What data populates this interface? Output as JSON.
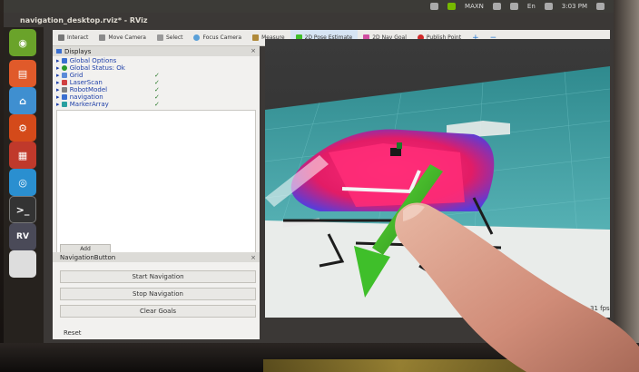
{
  "window": {
    "title": "navigation_desktop.rviz* - RViz"
  },
  "top_panel": {
    "network": "MAXN",
    "keyboard": "En",
    "time": "3:03 PM"
  },
  "toolbar": {
    "items": [
      {
        "label": "Interact",
        "icon": "cursor-icon"
      },
      {
        "label": "Move Camera",
        "icon": "move-camera-icon"
      },
      {
        "label": "Select",
        "icon": "select-icon"
      },
      {
        "label": "Focus Camera",
        "icon": "focus-icon"
      },
      {
        "label": "Measure",
        "icon": "ruler-icon"
      },
      {
        "label": "2D Pose Estimate",
        "icon": "green-arrow-icon"
      },
      {
        "label": "2D Nav Goal",
        "icon": "pink-arrow-icon"
      },
      {
        "label": "Publish Point",
        "icon": "red-pin-icon"
      }
    ]
  },
  "displays": {
    "title": "Displays",
    "items": [
      {
        "label": "Global Options",
        "checked": false
      },
      {
        "label": "Global Status: Ok",
        "checked": false
      },
      {
        "label": "Grid",
        "checked": true
      },
      {
        "label": "LaserScan",
        "checked": true
      },
      {
        "label": "RobotModel",
        "checked": true
      },
      {
        "label": "navigation",
        "checked": true
      },
      {
        "label": "MarkerArray",
        "checked": true
      }
    ],
    "add_label": "Add"
  },
  "navigation_panel": {
    "title": "NavigationButton",
    "buttons": [
      "Start Navigation",
      "Stop Navigation",
      "Clear Goals"
    ]
  },
  "footer": {
    "reset_label": "Reset",
    "fps": "31 fps"
  },
  "colors": {
    "accent": "#d6e4f3",
    "tree_text": "#1e3fa8",
    "costmap_pink": "#ff2d78",
    "costmap_blue": "#5a3cd8",
    "pose_arrow": "#3fbf2a"
  }
}
